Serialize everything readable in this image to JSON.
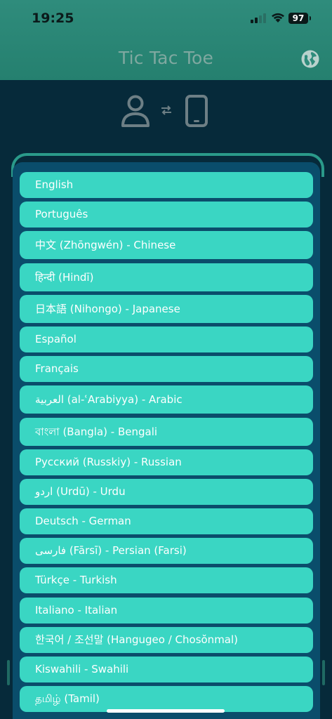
{
  "status_bar": {
    "time": "19:25",
    "battery": "97"
  },
  "header": {
    "title": "Tic Tac Toe"
  },
  "languages": [
    "English",
    "Português",
    "中文 (Zhōngwén) - Chinese",
    "हिन्दी (Hindī)",
    "日本語 (Nihongo) - Japanese",
    "Español",
    "Français",
    "العربية (al-ʿArabiyya) - Arabic",
    "বাংলা (Bangla) - Bengali",
    "Русский (Russkiy) - Russian",
    "اردو (Urdū) - Urdu",
    "Deutsch - German",
    "فارسی (Fārsī) - Persian (Farsi)",
    "Türkçe - Turkish",
    "Italiano - Italian",
    "한국어 / 조선말 (Hangugeo / Chosŏnmal)",
    "Kiswahili - Swahili",
    "தமிழ் (Tamil)"
  ],
  "colors": {
    "header": "#2f8c7c",
    "background": "#062a3a",
    "sheet": "#0a4d6b",
    "item": "#3ad6c3",
    "item_text": "#ffffff"
  },
  "icons": {
    "language": "globe-icon",
    "player": "person-icon",
    "swap": "swap-arrows-icon",
    "opponent": "phone-icon"
  }
}
